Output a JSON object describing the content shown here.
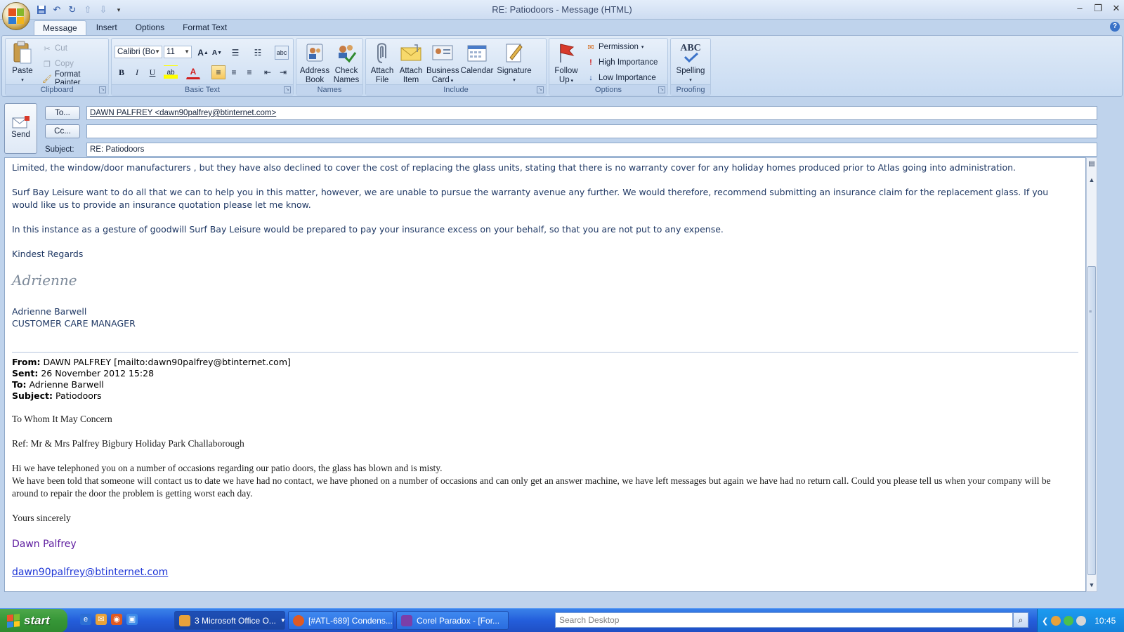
{
  "window": {
    "title": "RE: Patiodoors - Message (HTML)"
  },
  "ribbon": {
    "tabs": [
      {
        "label": "Message"
      },
      {
        "label": "Insert"
      },
      {
        "label": "Options"
      },
      {
        "label": "Format Text"
      }
    ],
    "clipboard": {
      "paste": "Paste",
      "cut": "Cut",
      "copy": "Copy",
      "format_painter": "Format Painter",
      "label": "Clipboard"
    },
    "basic_text": {
      "font": "Calibri (Bo",
      "size": "11",
      "label": "Basic Text"
    },
    "names": {
      "address_book_1": "Address",
      "address_book_2": "Book",
      "check_names_1": "Check",
      "check_names_2": "Names",
      "label": "Names"
    },
    "include": {
      "attach_file_1": "Attach",
      "attach_file_2": "File",
      "attach_item_1": "Attach",
      "attach_item_2": "Item",
      "business_card_1": "Business",
      "business_card_2": "Card",
      "calendar": "Calendar",
      "signature": "Signature",
      "label": "Include"
    },
    "options": {
      "follow_up_1": "Follow",
      "follow_up_2": "Up",
      "permission": "Permission",
      "high_importance": "High Importance",
      "low_importance": "Low Importance",
      "label": "Options"
    },
    "proofing": {
      "spelling": "Spelling",
      "abc": "ABC",
      "label": "Proofing"
    }
  },
  "header": {
    "send": "Send",
    "to_button": "To...",
    "cc_button": "Cc...",
    "subject_label": "Subject:",
    "to_value": "DAWN PALFREY <dawn90palfrey@btinternet.com>",
    "cc_value": "",
    "subject_value": "RE: Patiodoors"
  },
  "body": {
    "p1": "Limited, the window/door manufacturers ,  but they have also declined to cover the cost of replacing the glass units,  stating that there is no warranty cover for any holiday homes produced prior to Atlas going into administration.",
    "p2": "Surf Bay Leisure want to do all that we can to help you in this matter, however, we are unable to pursue the warranty avenue any further.   We would therefore, recommend submitting an insurance claim for the replacement glass.  If you would like us to provide an insurance quotation please let me know.",
    "p3": "In this instance as a gesture of goodwill Surf Bay Leisure would be prepared to pay your insurance excess on your behalf, so that you are not put to any expense.",
    "regards": "Kindest Regards",
    "signature": "Adrienne",
    "sender_name": "Adrienne Barwell",
    "sender_title": "CUSTOMER CARE MANAGER",
    "quoted": {
      "from_label": "From:",
      "from_value": "DAWN PALFREY [mailto:dawn90palfrey@btinternet.com]",
      "sent_label": "Sent:",
      "sent_value": "26 November 2012 15:28",
      "to_label": "To:",
      "to_value": "Adrienne Barwell",
      "subject_label": "Subject:",
      "subject_value": "Patiodoors",
      "greeting": "To Whom It May Concern",
      "ref": "Ref: Mr & Mrs Palfrey Bigbury Holiday Park Challaborough",
      "line1": "Hi we have telephoned you on a number of occasions regarding our patio doors, the glass has blown and is misty.",
      "line2": "We have been told that someone will contact us to date we have had no contact, we have phoned on a number of occasions and can only get an answer machine, we have left messages but again we have had no return call. Could you please tell us when your company will be around to repair the door the problem is getting worst each day.",
      "closing": "Yours sincerely",
      "name": "Dawn Palfrey",
      "email": "dawn90palfrey@btinternet.com"
    }
  },
  "taskbar": {
    "start": "start",
    "items": [
      {
        "label": "3 Microsoft Office O..."
      },
      {
        "label": "[#ATL-689] Condens..."
      },
      {
        "label": "Corel Paradox - [For..."
      }
    ],
    "search_placeholder": "Search Desktop",
    "clock": "10:45"
  },
  "colors": {
    "ribbon_bg": "#d3e2f4",
    "taskbar": "#245edb",
    "start": "#369637",
    "body_text": "#1f3864",
    "signature_purple": "#5d1b9e",
    "link": "#1d35d6"
  }
}
